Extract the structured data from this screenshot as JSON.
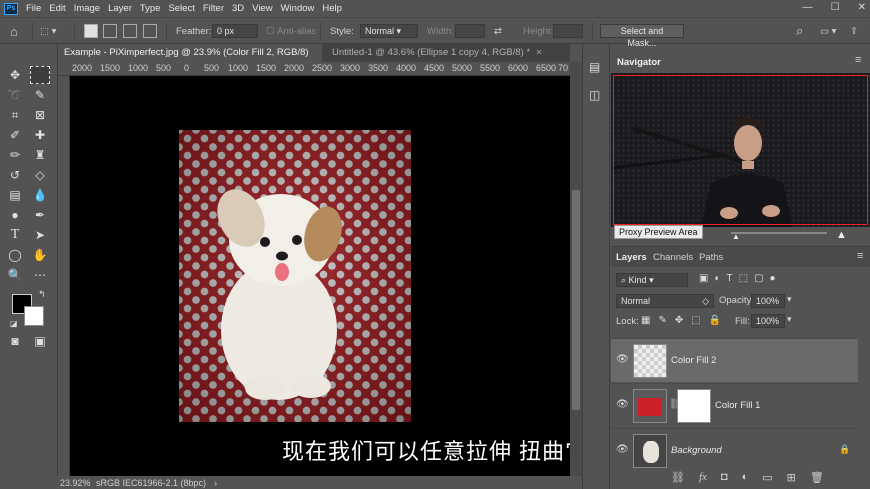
{
  "app": {
    "logo": "Ps"
  },
  "menu": [
    "File",
    "Edit",
    "Image",
    "Layer",
    "Type",
    "Select",
    "Filter",
    "3D",
    "View",
    "Window",
    "Help"
  ],
  "window_controls": {
    "minimize": "—",
    "maximize": "☐",
    "close": "✕"
  },
  "options": {
    "feather_label": "Feather:",
    "feather_value": "0 px",
    "antialias_label": "Anti-alias",
    "style_label": "Style:",
    "style_value": "Normal",
    "width_label": "Width:",
    "height_label": "Height:",
    "select_mask_label": "Select and Mask..."
  },
  "tabs": [
    {
      "label": "Example - PiXimperfect.jpg @ 23.9% (Color Fill 2, RGB/8) *",
      "close": "×"
    },
    {
      "label": "Untitled-1 @ 43.6% (Ellipse 1 copy 4, RGB/8) *",
      "close": "×"
    }
  ],
  "ruler_top": [
    "2000",
    "1500",
    "1000",
    "500",
    "0",
    "500",
    "1000",
    "1500",
    "2000",
    "2500",
    "3000",
    "3500",
    "4000",
    "4500",
    "5000",
    "5500",
    "6000",
    "6500",
    "70"
  ],
  "subtitle": "现在我们可以任意拉伸 扭曲它",
  "status": {
    "zoom": "23.92%",
    "profile": "sRGB IEC61966-2.1 (8bpc)",
    "arrow": "›"
  },
  "navigator": {
    "title": "Navigator",
    "tooltip": "Proxy Preview Area"
  },
  "layers": {
    "tabs": [
      "Layers",
      "Channels",
      "Paths"
    ],
    "filter_kind": "Kind",
    "blend_mode": "Normal",
    "opacity_label": "Opacity:",
    "opacity_value": "100%",
    "lock_label": "Lock:",
    "fill_label": "Fill:",
    "fill_value": "100%",
    "items": [
      {
        "name": "Color Fill 2",
        "selected": true
      },
      {
        "name": "Color Fill 1",
        "selected": false
      },
      {
        "name": "Background",
        "selected": false
      }
    ]
  },
  "colors": {
    "accent": "#31a8ff",
    "canvas_red": "#9a1c21",
    "fill_swatch": "#cc1f27"
  }
}
